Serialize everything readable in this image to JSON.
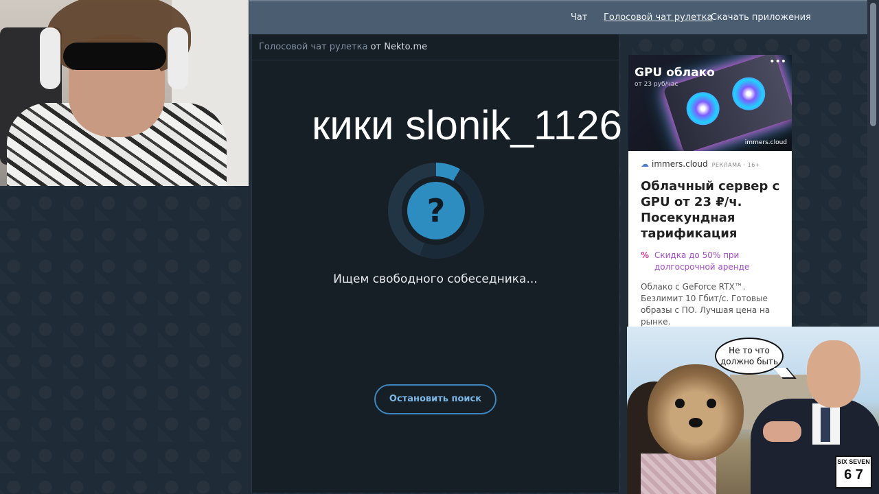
{
  "nav": {
    "items": [
      {
        "label": "Чат"
      },
      {
        "label": "Голосовой чат рулетка"
      },
      {
        "label": "Скачать приложения"
      }
    ]
  },
  "panel": {
    "header_highlight": "Голосовой чат рулетка",
    "header_rest": "от Nekto.me",
    "status_text": "Ищем свободного собеседника...",
    "stop_button": "Остановить поиск",
    "search_icon_glyph": "?"
  },
  "overlay": {
    "title": "кики slonik_1126"
  },
  "ad": {
    "banner_title": "GPU облако",
    "banner_subtitle": "от 23 руб/час",
    "banner_brand": "immers.cloud",
    "advertiser": "immers.cloud",
    "ad_label": "РЕКЛАМА · 16+",
    "headline": "Облачный сервер с GPU от 23 ₽/ч. Посекундная тарификация",
    "promo": "Скидка до 50% при долгосрочной аренде",
    "description": "Облако с GeForce RTX™. Безлимит 10 Гбит/с. Готовые образы с ПО. Лучшая цена на рынке."
  },
  "meme": {
    "bubble_line1": "Не то что",
    "bubble_line2": "должно быть",
    "badge_top": "SIX SEVEN",
    "badge_bottom": "6 7"
  },
  "colors": {
    "nav_bg": "#4b5d70",
    "panel_bg": "#161e26",
    "accent": "#2d8cc0",
    "button_border": "#3f87c0"
  }
}
